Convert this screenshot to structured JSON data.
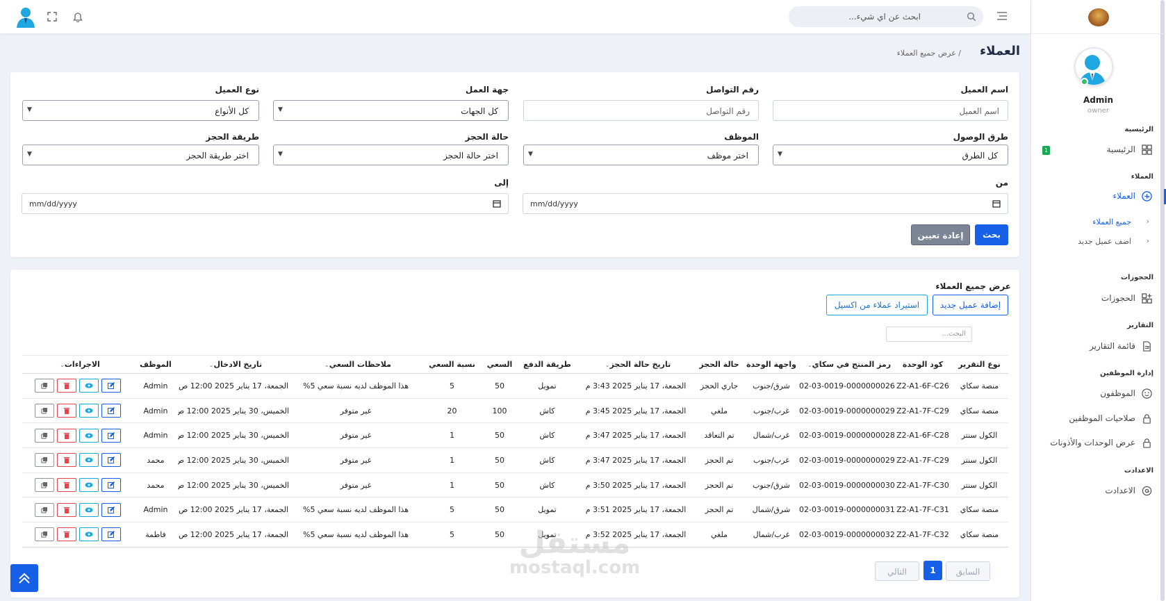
{
  "topbar": {
    "search_placeholder": "ابحث عن اي شيء..."
  },
  "sidebar": {
    "profile": {
      "name": "Admin",
      "role": "owner"
    },
    "sections": {
      "home": "الرئيسية",
      "clients": "العملاء",
      "bookings": "الحجوزات",
      "reports": "التقارير",
      "staff": "إدارة الموظفين",
      "settings": "الاعدادت"
    },
    "items": {
      "home": "الرئيسية",
      "home_badge": "1",
      "clients": "العملاء",
      "all_clients": "جميع العملاء",
      "add_client": "اضف عميل جديد",
      "bookings": "الحجوزات",
      "reports_list": "قائمة التقارير",
      "employees": "الموظفون",
      "employee_permissions": "صلاحيات الموظفين",
      "units_view": "عرض الوحدات والأذونات",
      "settings": "الاعدادت"
    }
  },
  "page": {
    "title": "العملاء",
    "breadcrumb": "/ عرض جميع العملاء"
  },
  "filters": {
    "client_name": {
      "label": "اسم العميل",
      "placeholder": "اسم العميل"
    },
    "contact_number": {
      "label": "رقم التواصل",
      "placeholder": "رقم التواصل"
    },
    "workplace": {
      "label": "جهة العمل",
      "value": "كل الجهات"
    },
    "client_type": {
      "label": "نوع العميل",
      "value": "كل الأنواع"
    },
    "arrival_method": {
      "label": "طرق الوصول",
      "value": "كل الطرق"
    },
    "employee": {
      "label": "الموظف",
      "value": "اختر موظف"
    },
    "booking_status": {
      "label": "حالة الحجز",
      "value": "اختر حالة الحجز"
    },
    "booking_method": {
      "label": "طريقة الحجز",
      "value": "اختر طريقة الحجز"
    },
    "from": {
      "label": "من",
      "placeholder": "mm/dd/yyyy"
    },
    "to": {
      "label": "إلى",
      "placeholder": "mm/dd/yyyy"
    },
    "search_button": "بحث",
    "reset_button": "إعادة تعيين"
  },
  "table_card": {
    "title": "عرض جميع العملاء",
    "add_button": "إضافة عميل جديد",
    "import_button": "استيراد عملاء من اكسيل",
    "search_placeholder": "البحث...",
    "columns": [
      "نوع التقرير",
      "كود الوحدة",
      "رمز المنتج في سكاي",
      "واجهة الوحدة",
      "حالة الحجز",
      "تاريخ حالة الحجز",
      "طريقة الدفع",
      "السعي",
      "نسبة السعي",
      "ملاحظات السعي",
      "تاريخ الادخال",
      "الموظف",
      "الاجراءات"
    ],
    "rows": [
      [
        "منصة سكاي",
        "Z2-A1-6F-C26",
        "02-03-0019-0000000026",
        "شرق/جنوب",
        "جاري الحجز",
        "الجمعة، 17 يناير 2025 3:43 م",
        "تمويل",
        "50",
        "5",
        "هذا الموظف لديه نسبة سعي 5%",
        "الجمعة، 17 يناير 2025 12:00 ص",
        "Admin"
      ],
      [
        "منصة سكاي",
        "Z2-A1-7F-C29",
        "02-03-0019-0000000029",
        "غرب/جنوب",
        "ملغي",
        "الجمعة، 17 يناير 2025 3:45 م",
        "كاش",
        "100",
        "20",
        "غير متوفر",
        "الخميس، 30 يناير 2025 12:00 ص",
        "Admin"
      ],
      [
        "الكول سنتر",
        "Z2-A1-6F-C28",
        "02-03-0019-0000000028",
        "غرب/شمال",
        "تم التعاقد",
        "الجمعة، 17 يناير 2025 3:47 م",
        "كاش",
        "50",
        "1",
        "غير متوفر",
        "الخميس، 30 يناير 2025 12:00 ص",
        "Admin"
      ],
      [
        "الكول سنتر",
        "Z2-A1-7F-C29",
        "02-03-0019-0000000029",
        "غرب/جنوب",
        "تم الحجز",
        "الجمعة، 17 يناير 2025 3:47 م",
        "كاش",
        "50",
        "1",
        "غير متوفر",
        "الخميس، 30 يناير 2025 12:00 ص",
        "محمد"
      ],
      [
        "الكول سنتر",
        "Z2-A1-7F-C30",
        "02-03-0019-0000000030",
        "شرق/جنوب",
        "تم الحجز",
        "الجمعة، 17 يناير 2025 3:50 م",
        "كاش",
        "50",
        "1",
        "غير متوفر",
        "الخميس، 30 يناير 2025 12:00 ص",
        "محمد"
      ],
      [
        "منصة سكاي",
        "Z2-A1-7F-C31",
        "02-03-0019-0000000031",
        "شرق/شمال",
        "تم الحجز",
        "الجمعة، 17 يناير 2025 3:51 م",
        "تمويل",
        "50",
        "5",
        "هذا الموظف لديه نسبة سعي 5%",
        "الجمعة، 17 يناير 2025 12:00 ص",
        "Admin"
      ],
      [
        "منصة سكاي",
        "Z2-A1-7F-C32",
        "02-03-0019-0000000032",
        "غرب/شمال",
        "ملغي",
        "الجمعة، 17 يناير 2025 3:52 م",
        "تمويل",
        "50",
        "5",
        "هذا الموظف لديه نسبة سعي 5%",
        "الجمعة، 17 يناير 2025 12:00 ص",
        "فاطمة"
      ]
    ]
  },
  "pagination": {
    "prev": "السابق",
    "current": "1",
    "next": "التالي"
  },
  "watermark": {
    "arabic": "مستقل",
    "latin": "mostaql.com"
  },
  "colors": {
    "primary": "#1560e6",
    "danger": "#e5444b",
    "info": "#17a8e0",
    "success": "#19a853",
    "muted_button": "#7b8596"
  }
}
